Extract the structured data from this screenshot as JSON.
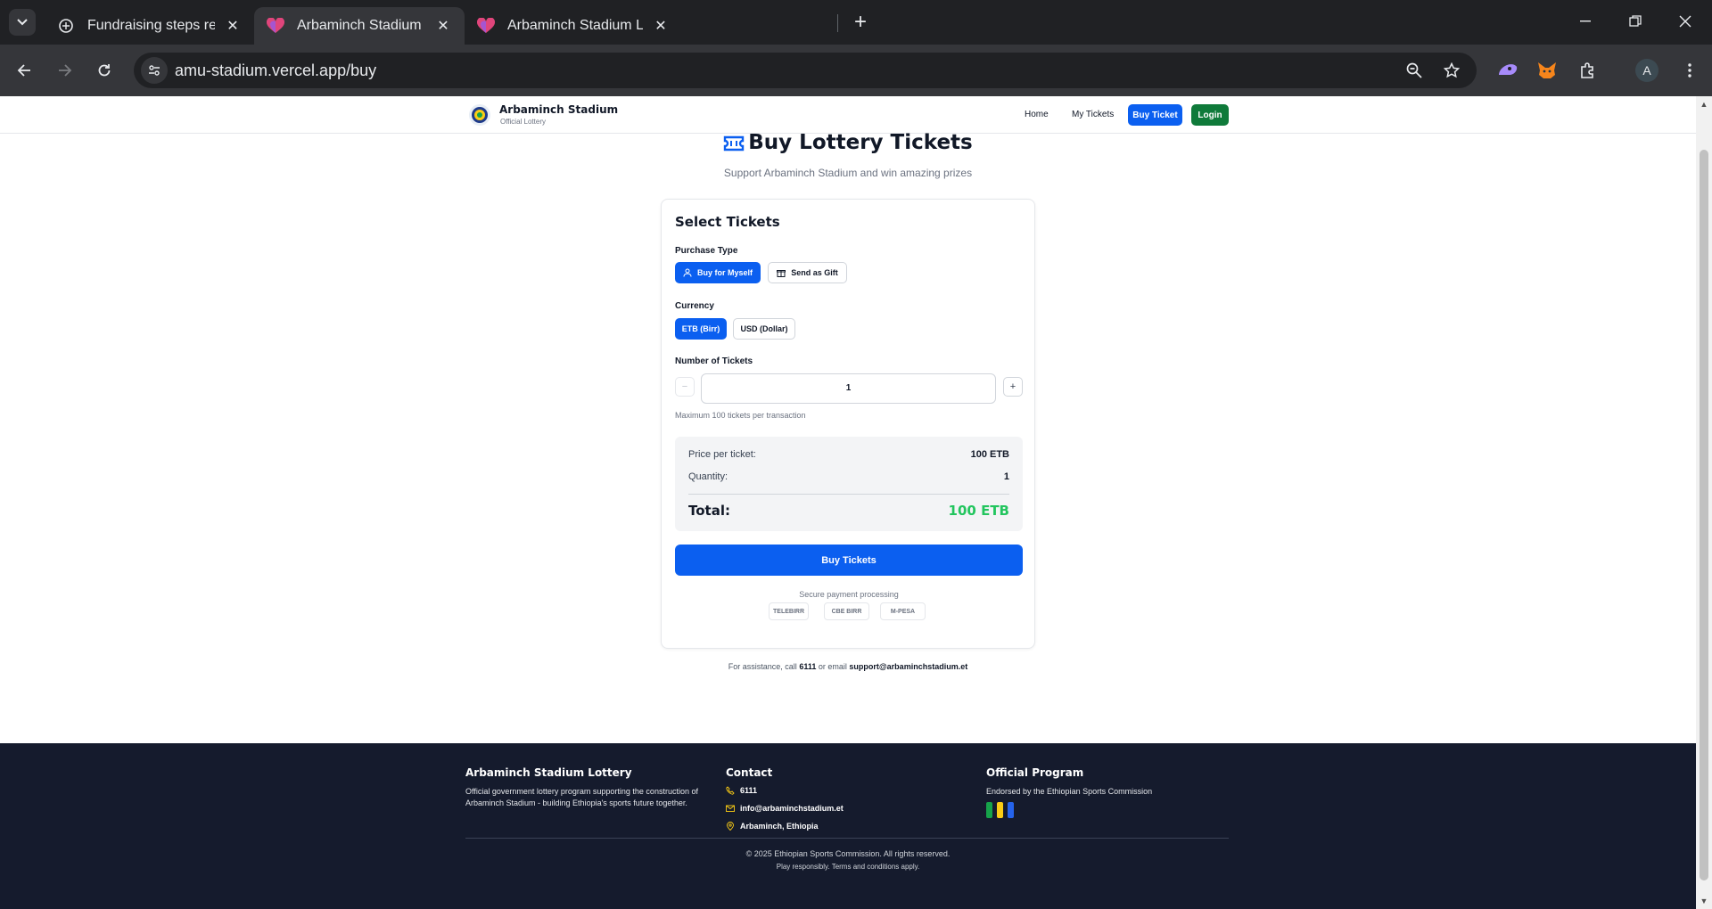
{
  "browser": {
    "tabs": [
      {
        "title": "Fundraising steps review",
        "icon": "chatgpt-icon",
        "active": false
      },
      {
        "title": "Arbaminch Stadium Lottery | Su",
        "icon": "heart-icon",
        "active": true
      },
      {
        "title": "Arbaminch Stadium Lottery | Su",
        "icon": "heart-icon",
        "active": false
      }
    ],
    "url": "amu-stadium.vercel.app/buy",
    "profile_initial": "A"
  },
  "site": {
    "brand_name": "Arbaminch Stadium",
    "brand_sub": "Official Lottery",
    "nav": {
      "home": "Home",
      "my_tickets": "My Tickets",
      "buy_ticket": "Buy Ticket",
      "login": "Login"
    }
  },
  "page": {
    "title": "Buy Lottery Tickets",
    "subtitle": "Support Arbaminch Stadium and win amazing prizes"
  },
  "form": {
    "title": "Select Tickets",
    "purchase_type": {
      "label": "Purchase Type",
      "options": [
        "Buy for Myself",
        "Send as Gift"
      ],
      "selected": "Buy for Myself"
    },
    "currency": {
      "label": "Currency",
      "options": [
        "ETB (Birr)",
        "USD (Dollar)"
      ],
      "selected": "ETB (Birr)"
    },
    "tickets": {
      "label": "Number of Tickets",
      "value": "1",
      "decrement": "−",
      "increment": "+",
      "hint": "Maximum 100 tickets per transaction"
    },
    "summary": {
      "price_label": "Price per ticket:",
      "price_value": "100 ETB",
      "quantity_label": "Quantity:",
      "quantity_value": "1",
      "total_label": "Total:",
      "total_value": "100 ETB"
    },
    "buy_button": "Buy Tickets",
    "secure_text": "Secure payment processing",
    "payment_methods": [
      "TELEBIRR",
      "CBE BIRR",
      "M-PESA"
    ]
  },
  "assist": {
    "prefix": "For assistance, call",
    "phone": "6111",
    "middle": "or email",
    "email": "support@arbaminchstadium.et"
  },
  "footer": {
    "about_title": "Arbaminch Stadium Lottery",
    "about_text": "Official government lottery program supporting the construction of Arbaminch Stadium - building Ethiopia's sports future together.",
    "contact_title": "Contact",
    "contact_phone": "6111",
    "contact_email": "info@arbaminchstadium.et",
    "contact_location": "Arbaminch, Ethiopia",
    "program_title": "Official Program",
    "program_text": "Endorsed by the Ethiopian Sports Commission",
    "copyright": "© 2025 Ethiopian Sports Commission. All rights reserved.",
    "disclaimer": "Play responsibly. Terms and conditions apply."
  },
  "colors": {
    "primary": "#0b5ff0",
    "login": "#0f7a3a",
    "total": "#22c55e",
    "footer_bg": "#151b2d",
    "flag": [
      "#16a34a",
      "#facc15",
      "#2563eb"
    ]
  }
}
